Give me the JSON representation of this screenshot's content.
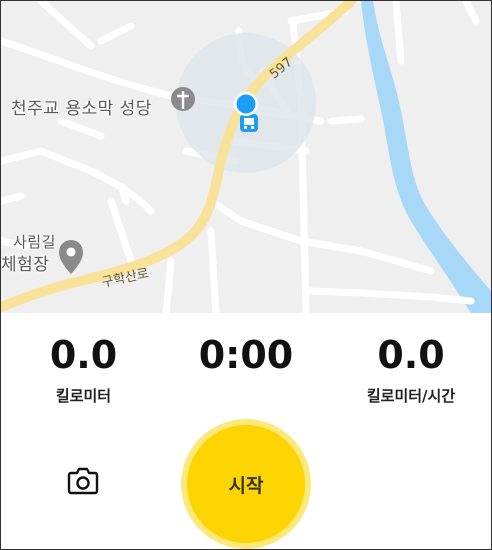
{
  "map": {
    "places": [
      {
        "id": "church",
        "label": "천주교 용소막 성당"
      },
      {
        "id": "forest",
        "label": "사림길"
      },
      {
        "id": "experience",
        "label": "체험장"
      }
    ],
    "roads": {
      "route_number": "597",
      "local_road": "구학산로"
    },
    "colors": {
      "water": "#a8d8f8",
      "main_road": "#f8e29a",
      "location_dot": "#1a9ef5"
    }
  },
  "stats": {
    "distance": {
      "value": "0.0",
      "label": "킬로미터"
    },
    "time": {
      "value": "0:00"
    },
    "speed": {
      "value": "0.0",
      "label": "킬로미터/시간"
    }
  },
  "controls": {
    "start_label": "시작",
    "camera_icon": "camera-icon",
    "accent": "#fcd400"
  }
}
